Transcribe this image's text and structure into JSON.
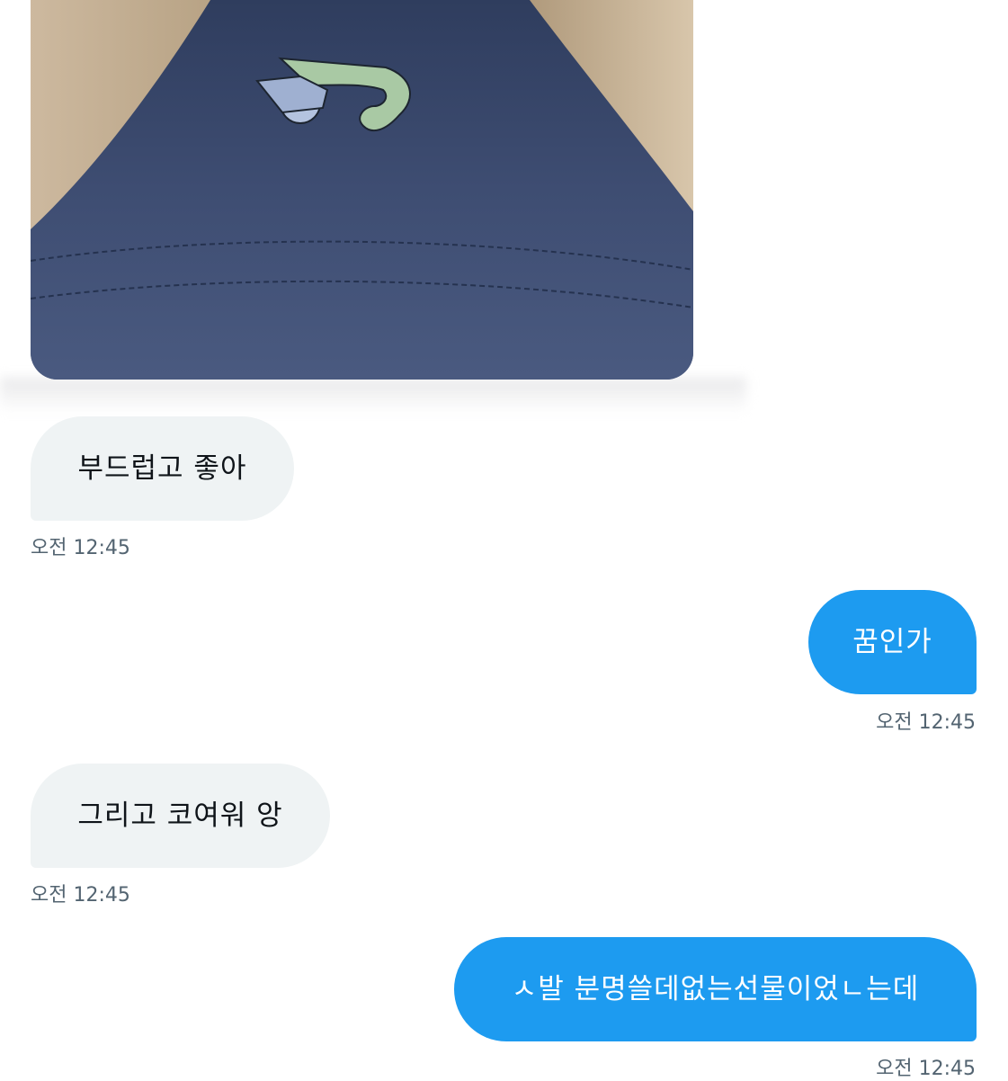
{
  "conversation": {
    "messages": [
      {
        "direction": "incoming",
        "text": "부드럽고 좋아",
        "time": "오전 12:45"
      },
      {
        "direction": "outgoing",
        "text": "꿈인가",
        "time": "오전 12:45"
      },
      {
        "direction": "incoming",
        "text": "그리고 코여워 앙",
        "time": "오전 12:45"
      },
      {
        "direction": "outgoing",
        "text": "ㅅ발 분명쓸데없는선물이었ㄴ는데",
        "time": "오전 12:45"
      }
    ]
  },
  "colors": {
    "incoming_bubble": "#eff3f4",
    "outgoing_bubble": "#1d9bf0",
    "timestamp": "#536471",
    "photo_fabric": "#3c4b6f",
    "photo_fleece": "#c9b59a"
  }
}
